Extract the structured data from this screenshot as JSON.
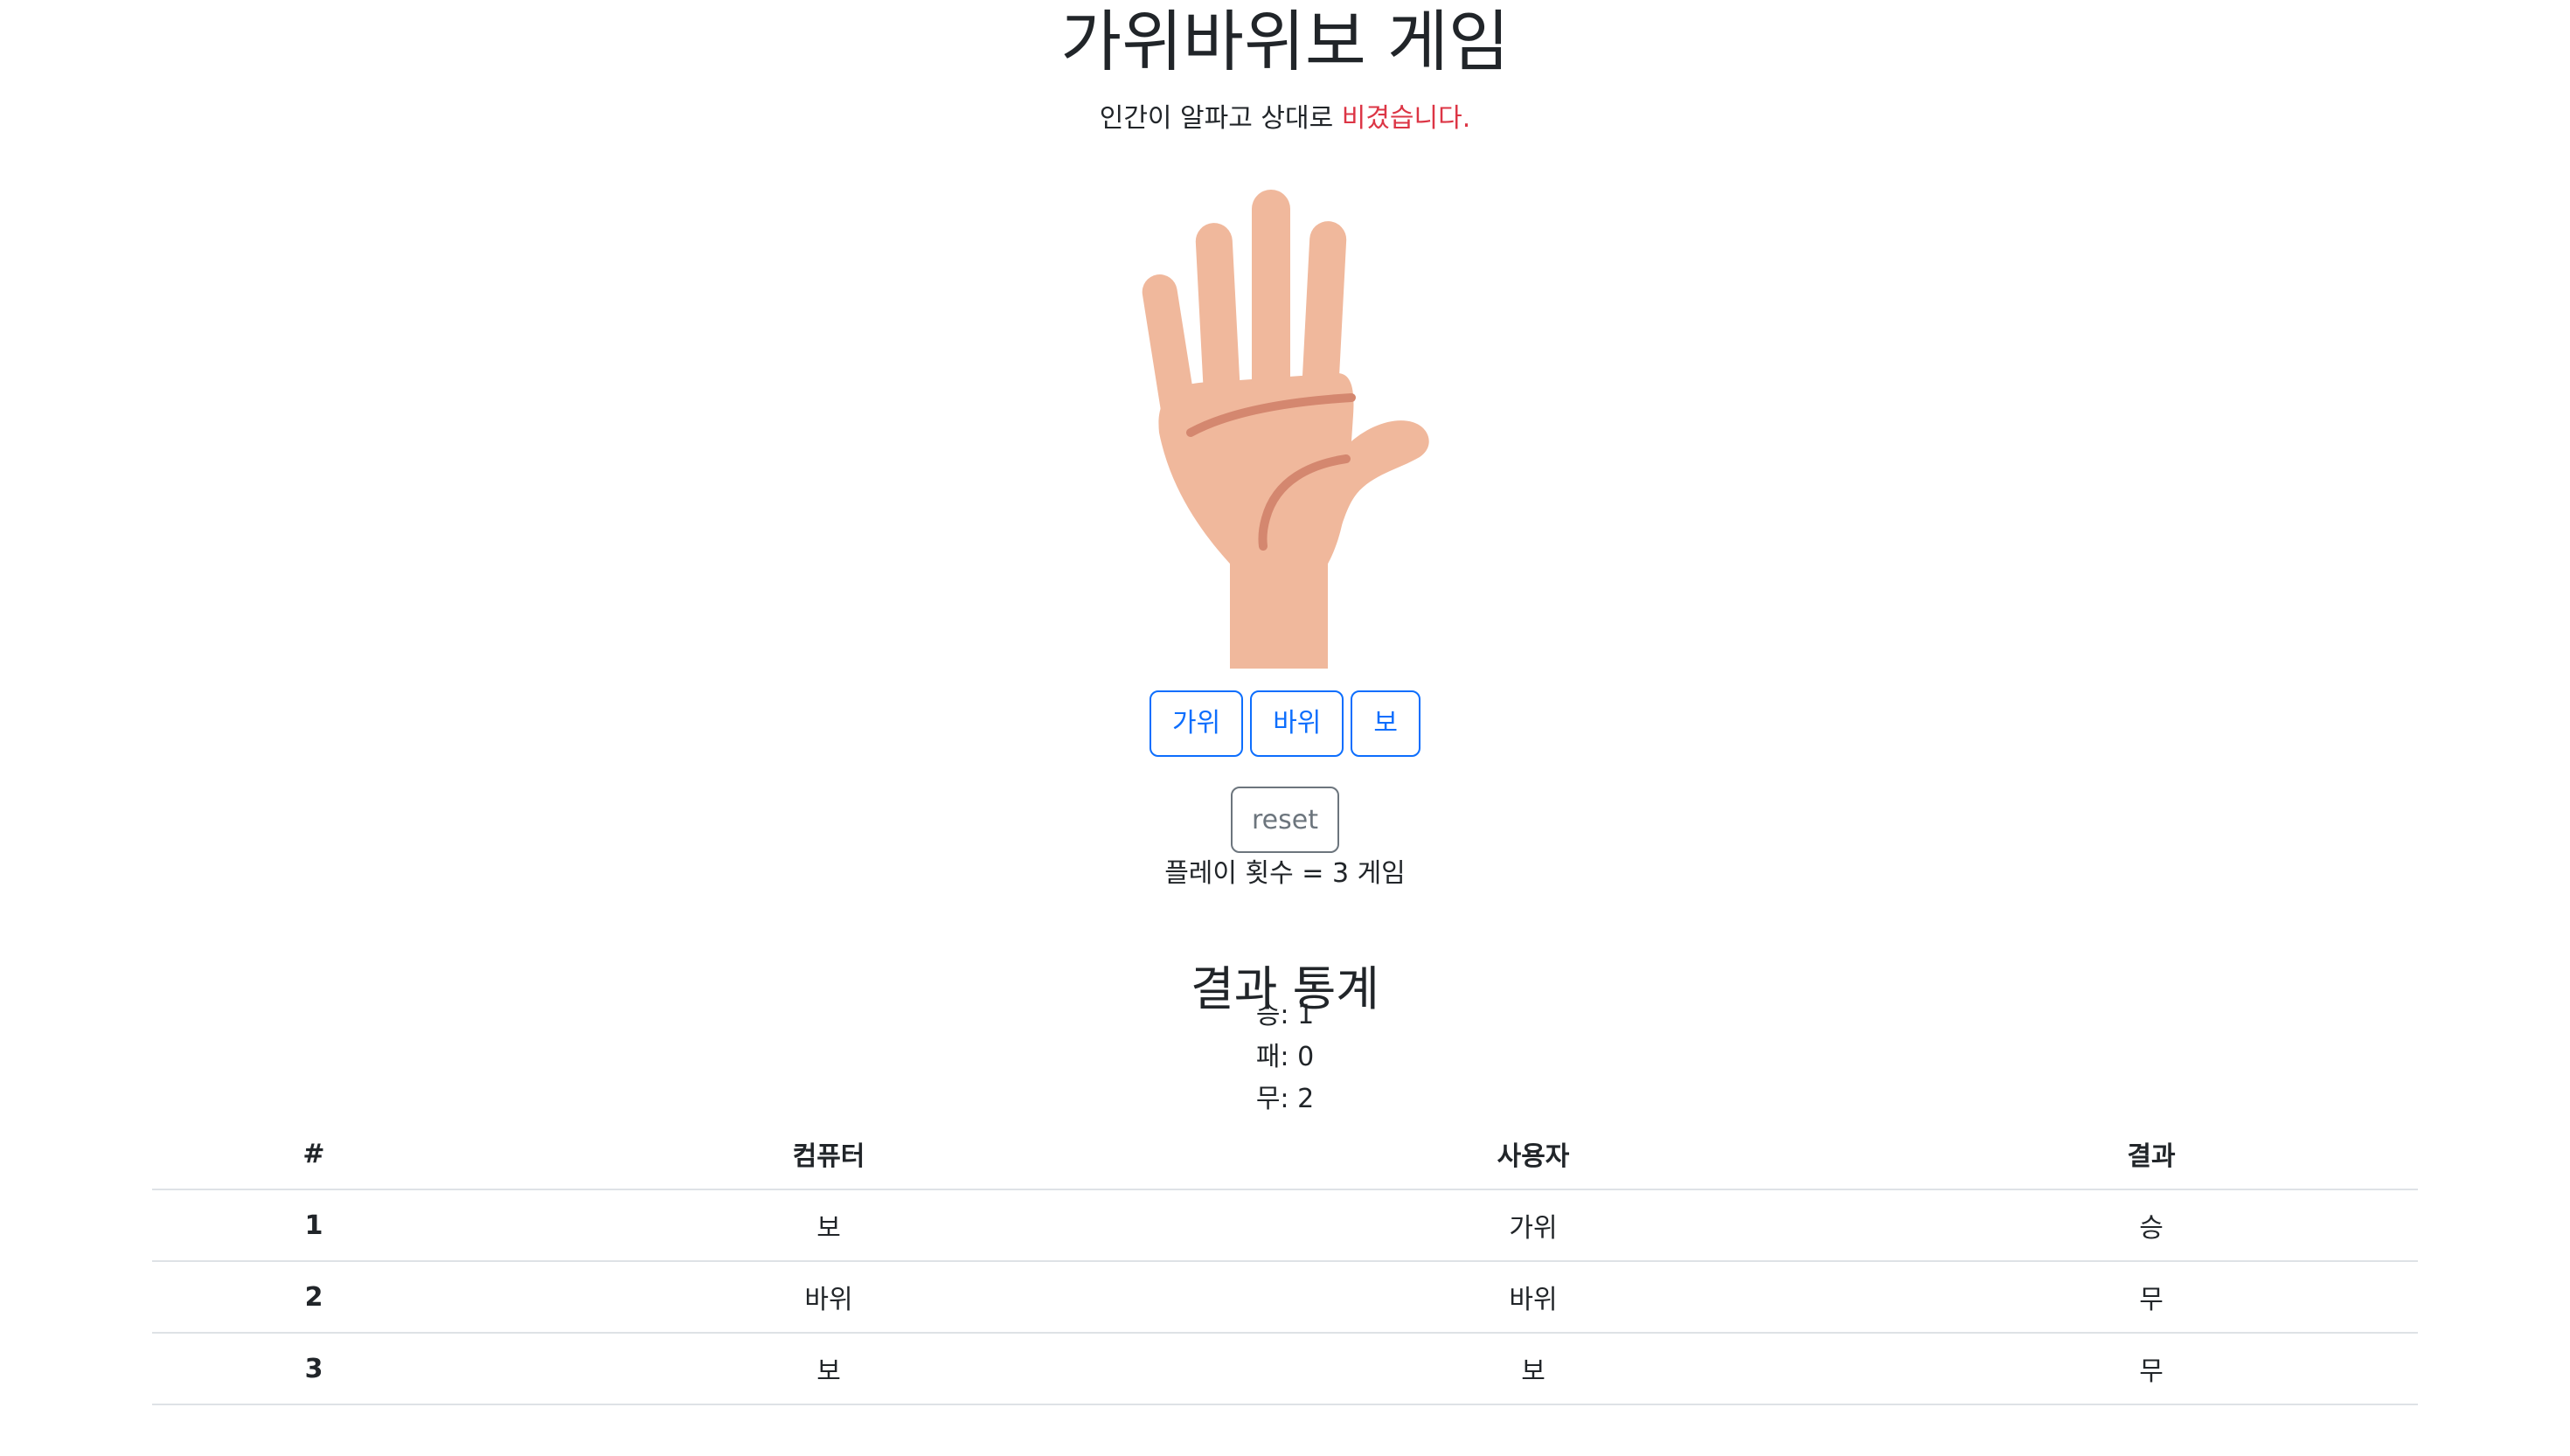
{
  "header": {
    "title": "가위바위보 게임"
  },
  "status": {
    "prefix": "인간이 알파고 상대로 ",
    "result": "비겼습니다.",
    "result_color": "#dc3545"
  },
  "hand_image": {
    "icon": "open-palm-hand",
    "skin_color": "#f0b89c",
    "line_color": "#d4876f"
  },
  "choices": {
    "scissors_label": "가위",
    "rock_label": "바위",
    "paper_label": "보",
    "accent_color": "#0d6efd"
  },
  "reset": {
    "label": "reset"
  },
  "play_count": {
    "text": "플레이 횟수 = 3 게임"
  },
  "stats": {
    "title": "결과 통계",
    "win": "승: 1",
    "lose": "패: 0",
    "draw": "무: 2"
  },
  "history": {
    "headers": [
      "#",
      "컴퓨터",
      "사용자",
      "결과"
    ],
    "rows": [
      [
        "1",
        "보",
        "가위",
        "승"
      ],
      [
        "2",
        "바위",
        "바위",
        "무"
      ],
      [
        "3",
        "보",
        "보",
        "무"
      ]
    ]
  }
}
